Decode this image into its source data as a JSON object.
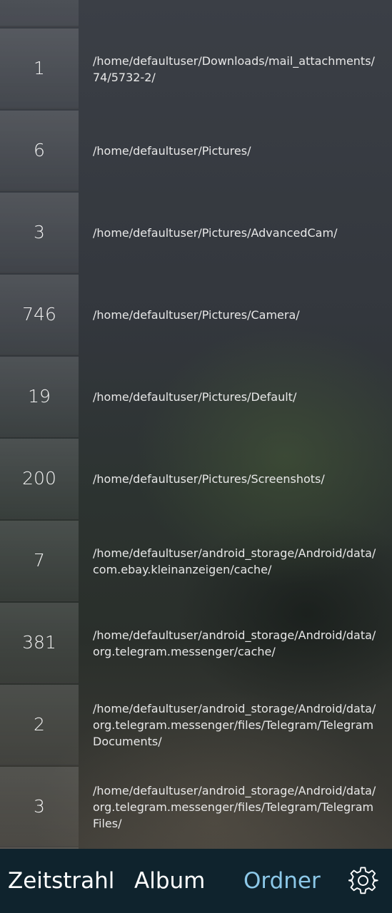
{
  "folders": [
    {
      "count": "1",
      "path_lines": [
        "/home/defaultuser/Downloads/mail_attachments/",
        "74/5732-2/"
      ]
    },
    {
      "count": "6",
      "path_lines": [
        "/home/defaultuser/Pictures/"
      ]
    },
    {
      "count": "3",
      "path_lines": [
        "/home/defaultuser/Pictures/AdvancedCam/"
      ]
    },
    {
      "count": "746",
      "path_lines": [
        "/home/defaultuser/Pictures/Camera/"
      ]
    },
    {
      "count": "19",
      "path_lines": [
        "/home/defaultuser/Pictures/Default/"
      ]
    },
    {
      "count": "200",
      "path_lines": [
        "/home/defaultuser/Pictures/Screenshots/"
      ]
    },
    {
      "count": "7",
      "path_lines": [
        "/home/defaultuser/android_storage/Android/data/",
        "com.ebay.kleinanzeigen/cache/"
      ]
    },
    {
      "count": "381",
      "path_lines": [
        "/home/defaultuser/android_storage/Android/data/",
        "org.telegram.messenger/cache/"
      ]
    },
    {
      "count": "2",
      "path_lines": [
        "/home/defaultuser/android_storage/Android/data/",
        "org.telegram.messenger/files/Telegram/Telegram",
        "Documents/"
      ]
    },
    {
      "count": "3",
      "path_lines": [
        "/home/defaultuser/android_storage/Android/data/",
        "org.telegram.messenger/files/Telegram/Telegram",
        "Files/"
      ]
    }
  ],
  "nav": {
    "timeline_label": "Zeitstrahl",
    "album_label": "Album",
    "folders_label": "Ordner",
    "settings_icon": "gear-icon",
    "active_color": "#8cc8e8"
  }
}
